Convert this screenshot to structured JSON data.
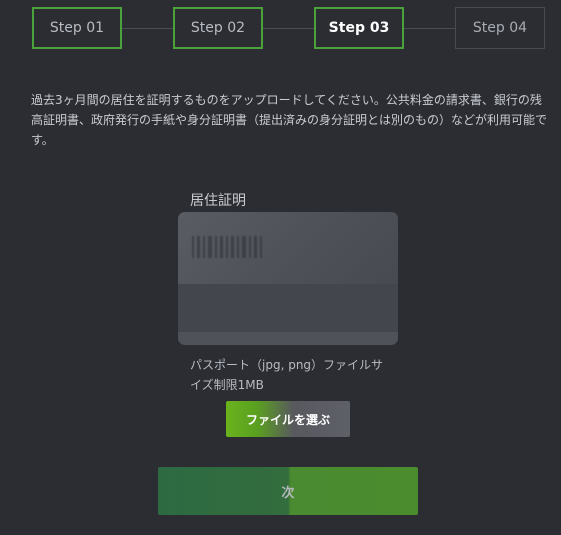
{
  "stepper": {
    "steps": [
      {
        "label": "Step 01",
        "state": "done"
      },
      {
        "label": "Step 02",
        "state": "done"
      },
      {
        "label": "Step 03",
        "state": "active"
      },
      {
        "label": "Step 04",
        "state": "todo"
      }
    ]
  },
  "instructions": "過去3ヶ月間の居住を証明するものをアップロードしてください。公共料金の請求書、銀行の残高証明書、政府発行の手紙や身分証明書（提出済みの身分証明とは別のもの）などが利用可能です。",
  "upload": {
    "title": "居住証明",
    "hint": "パスポート（jpg, png）ファイルサイズ制限1MB",
    "choose_button": "ファイルを選ぶ"
  },
  "next_button": "次",
  "colors": {
    "background": "#2b2d33",
    "accent_green": "#4aa33a",
    "button_green": "#6ab31d"
  }
}
